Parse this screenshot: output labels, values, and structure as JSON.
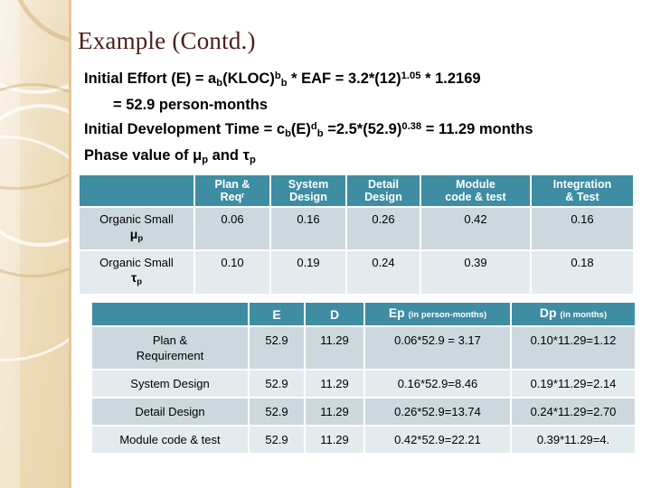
{
  "slide": {
    "title": "Example (Contd.)",
    "title_color": "#4a1f1a",
    "accent_color": "#3e8da2",
    "band_a_color": "#ccd8de",
    "band_b_color": "#e4ebef"
  },
  "body": {
    "line1_prefix": "Initial Effort (E)  = a",
    "line1_sub1": "b",
    "line1_mid": "(KLOC)",
    "line1_sup1": "b",
    "line1_sub2": "b",
    "line1_mid2": " * EAF = 3.2*(12)",
    "line1_sup2": "1.05",
    "line1_tail": " * 1.2169",
    "line2": "=  52.9 person-months",
    "line3_prefix": "Initial Development Time = c",
    "line3_sub1": "b",
    "line3_mid": "(E)",
    "line3_sup1": "d",
    "line3_sub2": "b",
    "line3_mid2": " =2.5*(52.9)",
    "line3_sup2": "0.38",
    "line3_tail": " = 11.29 months",
    "line4_prefix": "Phase value of μ",
    "line4_sub1": "p",
    "line4_mid": " and τ",
    "line4_sub2": "p"
  },
  "table1": {
    "headers": [
      "",
      "Plan & Reqʳ",
      "System Design",
      "Detail Design",
      "Module code & test",
      "Integration & Test"
    ],
    "headers_line1": [
      "",
      "Plan &",
      "System",
      "Detail",
      "Module",
      "Integration"
    ],
    "headers_line2": [
      "",
      "Reqʳ",
      "Design",
      "Design",
      "code & test",
      "& Test"
    ],
    "rows": [
      {
        "label_line1": "Organic Small",
        "label_line2": "μ",
        "label_sub": "p",
        "values": [
          "0.06",
          "0.16",
          "0.26",
          "0.42",
          "0.16"
        ]
      },
      {
        "label_line1": "Organic Small",
        "label_line2": "τ",
        "label_sub": "p",
        "values": [
          "0.10",
          "0.19",
          "0.24",
          "0.39",
          "0.18"
        ]
      }
    ]
  },
  "table2": {
    "headers": [
      "",
      "E",
      "D",
      "Ep",
      "Dp"
    ],
    "header_ep_note": "(in person-months)",
    "header_dp_note": "(in months)",
    "rows": [
      {
        "label": "Plan & Requirement",
        "label_line1": "Plan &",
        "label_line2": "Requirement",
        "e": "52.9",
        "d": "11.29",
        "ep": "0.06*52.9 = 3.17",
        "dp": "0.10*11.29=1.12"
      },
      {
        "label": "System Design",
        "label_line1": "System Design",
        "label_line2": "",
        "e": "52.9",
        "d": "11.29",
        "ep": "0.16*52.9=8.46",
        "dp": "0.19*11.29=2.14"
      },
      {
        "label": "Detail Design",
        "label_line1": "Detail Design",
        "label_line2": "",
        "e": "52.9",
        "d": "11.29",
        "ep": "0.26*52.9=13.74",
        "dp": "0.24*11.29=2.70"
      },
      {
        "label": "Module code & test",
        "label_line1": "Module code & test",
        "label_line2": "",
        "e": "52.9",
        "d": "11.29",
        "ep": "0.42*52.9=22.21",
        "dp": "0.39*11.29=4."
      }
    ]
  }
}
